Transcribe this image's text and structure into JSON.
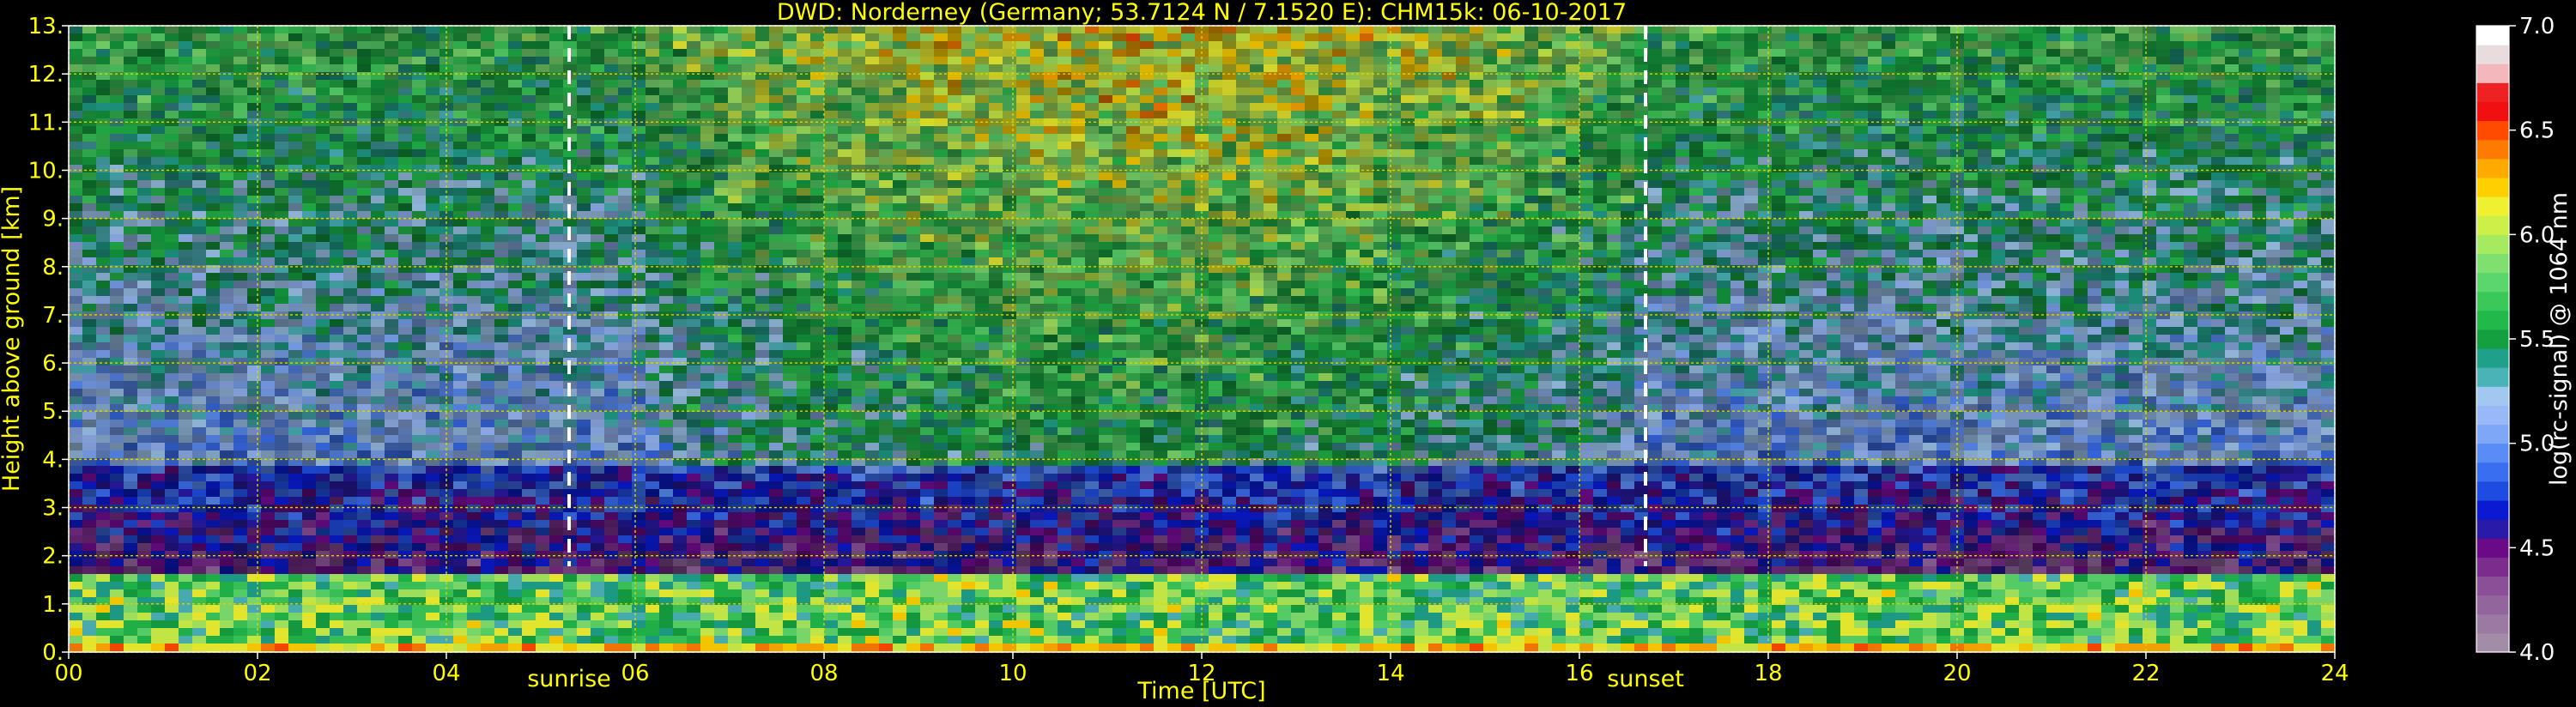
{
  "chart_data": {
    "type": "heatmap",
    "title": "DWD: Norderney (Germany; 53.7124 N / 7.1520 E):    CHM15k: 06-10-2017",
    "xlabel": "Time [UTC]",
    "ylabel": "Height above ground [km]",
    "colorbar_label": "log(rc-signal) @ 1064 nm",
    "xlim": [
      0,
      24
    ],
    "ylim": [
      0,
      13
    ],
    "clim": [
      4.0,
      7.0
    ],
    "x_ticks": [
      "00",
      "02",
      "04",
      "06",
      "08",
      "10",
      "12",
      "14",
      "16",
      "18",
      "20",
      "22",
      "24"
    ],
    "y_ticks": [
      "0.",
      "1.",
      "2.",
      "3.",
      "4.",
      "5.",
      "6.",
      "7.",
      "8.",
      "9.",
      "10.",
      "11.",
      "12.",
      "13."
    ],
    "colorbar_ticks": [
      "4.0",
      "4.5",
      "5.0",
      "5.5",
      "6.0",
      "6.5",
      "7.0"
    ],
    "grid": true,
    "annotations": [
      {
        "label": "sunrise",
        "x": 5.3
      },
      {
        "label": "sunset",
        "x": 16.7
      }
    ],
    "colormap": [
      "#a28ca8",
      "#9a7aa3",
      "#92669d",
      "#8a4f97",
      "#7a2d8c",
      "#6a0a87",
      "#2a1aaa",
      "#0a1ad0",
      "#1f4ce0",
      "#3a6ef0",
      "#5a8cf5",
      "#7fa7f7",
      "#98b8f8",
      "#a0c8f0",
      "#4ab3b8",
      "#1fa08a",
      "#14a040",
      "#22b84a",
      "#3ac858",
      "#5ad66c",
      "#7fe070",
      "#a6ea60",
      "#ccf048",
      "#eef030",
      "#ffd000",
      "#ffaa00",
      "#ff7a00",
      "#ff4a00",
      "#f01010",
      "#ee2222",
      "#f4b8bc",
      "#e8dcdc",
      "#ffffff"
    ],
    "colors": {
      "text": "#ffff00",
      "grid": "#d8d800",
      "marker": "#ffffff",
      "background": "#000000"
    }
  }
}
